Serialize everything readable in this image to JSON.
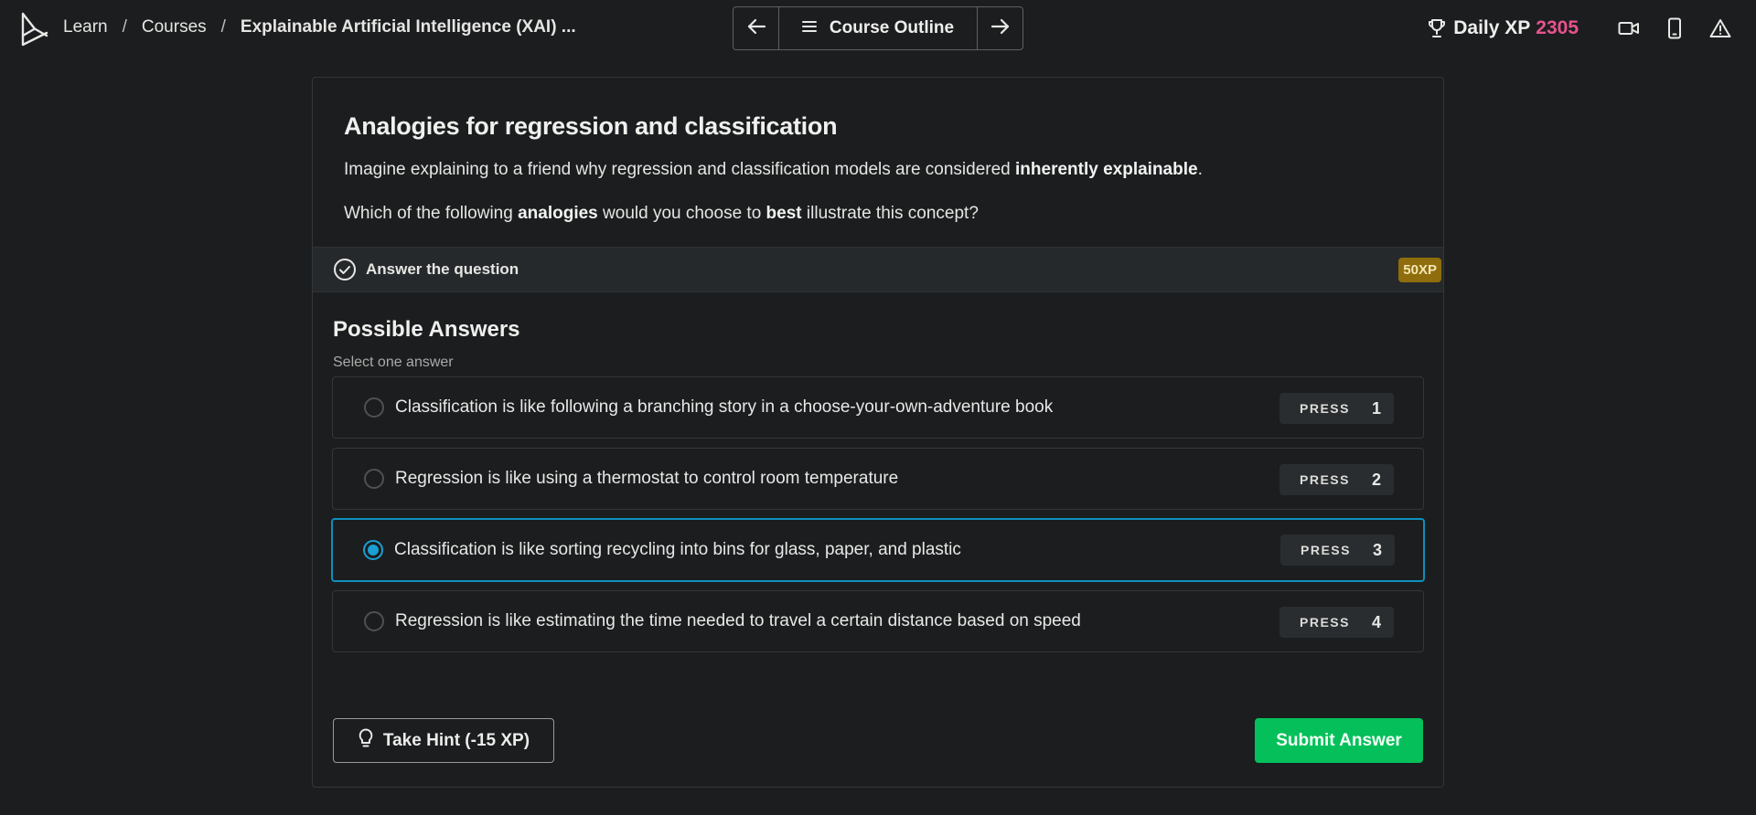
{
  "header": {
    "logo_icon": "datacamp-logo-icon",
    "breadcrumb": {
      "learn": "Learn",
      "courses": "Courses",
      "current": "Explainable Artificial Intelligence (XAI) ...",
      "separator": "/"
    },
    "nav": {
      "prev_icon": "arrow-left-icon",
      "outline_label": "Course Outline",
      "outline_icon": "menu-icon",
      "next_icon": "arrow-right-icon"
    },
    "daily_xp": {
      "label": "Daily XP",
      "value": "2305",
      "icon": "trophy-icon",
      "value_color": "#e8528c"
    },
    "icons": [
      "video-icon",
      "mobile-icon",
      "warning-icon"
    ]
  },
  "exercise": {
    "title": "Analogies for regression and classification",
    "paragraph1": {
      "before": "Imagine explaining to a friend why regression and classification models are considered ",
      "bold": "inherently explainable",
      "after": "."
    },
    "paragraph2": {
      "before": "Which of the following ",
      "bold1": "analogies",
      "middle": " would you choose to ",
      "bold2": "best",
      "after": " illustrate this concept?"
    },
    "instruction": "Answer the question",
    "xp_badge": "50XP"
  },
  "answers": {
    "heading": "Possible Answers",
    "subheading": "Select one answer",
    "selected_index": 2,
    "options": [
      {
        "text": "Classification is like following a branching story in a choose-your-own-adventure book",
        "press_label": "PRESS",
        "key": "1"
      },
      {
        "text": "Regression is like using a thermostat to control room temperature",
        "press_label": "PRESS",
        "key": "2"
      },
      {
        "text": "Classification is like sorting recycling into bins for glass, paper, and plastic",
        "press_label": "PRESS",
        "key": "3"
      },
      {
        "text": "Regression is like estimating the time needed to travel a certain distance based on speed",
        "press_label": "PRESS",
        "key": "4"
      }
    ]
  },
  "actions": {
    "hint_label": "Take Hint (-15 XP)",
    "hint_icon": "lightbulb-icon",
    "submit_label": "Submit Answer",
    "submit_color": "#05c05a",
    "selected_color": "#1a9fd4"
  }
}
